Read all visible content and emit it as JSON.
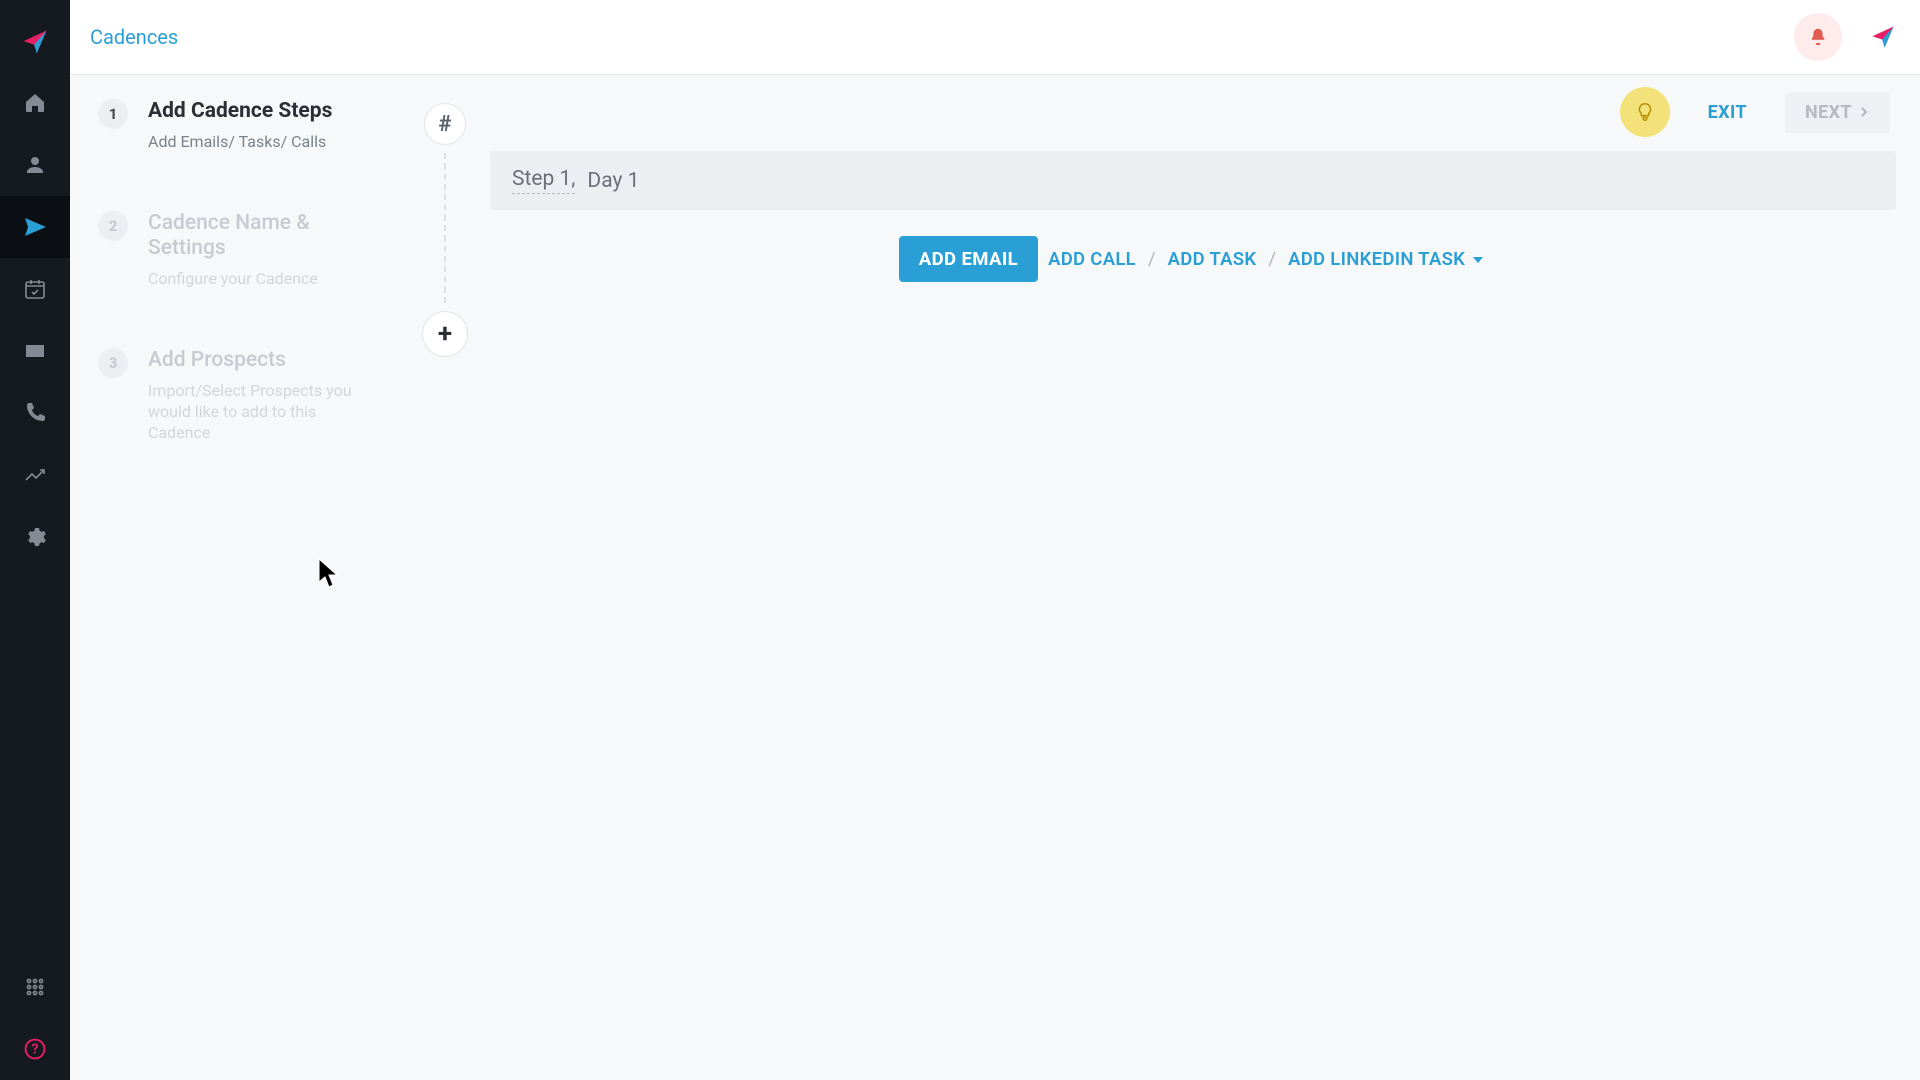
{
  "breadcrumb": "Cadences",
  "page_actions": {
    "exit": "EXIT",
    "next": "NEXT"
  },
  "wizard": [
    {
      "num": "1",
      "title": "Add Cadence Steps",
      "sub": "Add Emails/ Tasks/ Calls",
      "active": true
    },
    {
      "num": "2",
      "title": "Cadence Name & Settings",
      "sub": "Configure your Cadence",
      "active": false
    },
    {
      "num": "3",
      "title": "Add Prospects",
      "sub": "Import/Select Prospects you would like to add to this Cadence",
      "active": false
    }
  ],
  "timeline": {
    "node_glyph": "#",
    "add_glyph": "+"
  },
  "step_bar": {
    "step": "Step 1,",
    "day": "Day 1"
  },
  "actions": {
    "add_email": "ADD EMAIL",
    "add_call": "ADD CALL",
    "add_task": "ADD TASK",
    "add_linkedin": "ADD LINKEDIN TASK",
    "sep": "/"
  },
  "sidebar_icons": [
    "home-icon",
    "user-icon",
    "send-icon",
    "calendar-icon",
    "mail-icon",
    "phone-icon",
    "analytics-icon",
    "settings-icon"
  ],
  "bottom_icons": [
    "dialpad-icon",
    "help-icon"
  ],
  "colors": {
    "accent": "#2a9fd6",
    "rail": "#151a20",
    "pink": "#e91e63",
    "bulb": "#f3e27a"
  }
}
